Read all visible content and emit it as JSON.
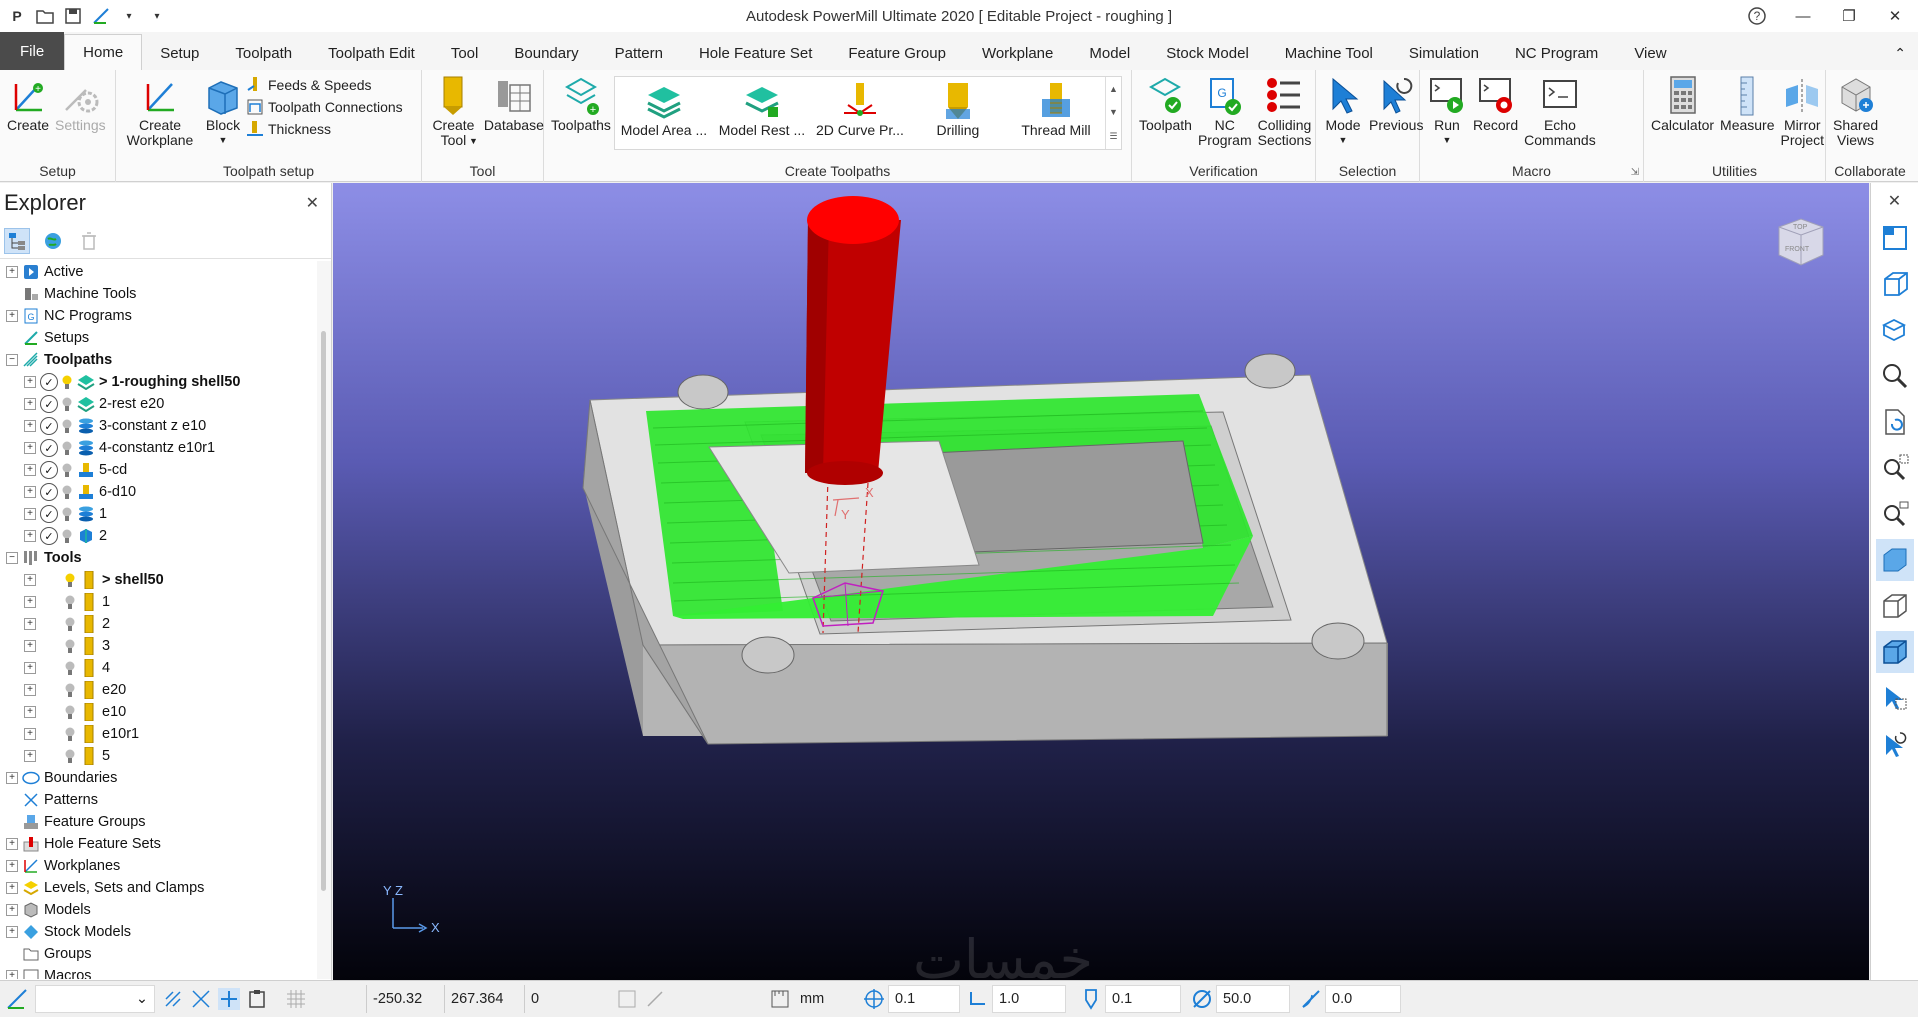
{
  "app": {
    "title": "Autodesk PowerMill Ultimate 2020    [ Editable Project - roughing ]",
    "logo": "P"
  },
  "colors": {
    "accent": "#1e7fd6",
    "toolpath_green": "#33ee33",
    "tool_red": "#d60000",
    "file_tab": "#4b4b4b"
  },
  "tabs": [
    "File",
    "Home",
    "Setup",
    "Toolpath",
    "Toolpath Edit",
    "Tool",
    "Boundary",
    "Pattern",
    "Hole Feature Set",
    "Feature Group",
    "Workplane",
    "Model",
    "Stock Model",
    "Machine Tool",
    "Simulation",
    "NC Program",
    "View"
  ],
  "ribbon": {
    "setup": {
      "label": "Setup",
      "create": "Create",
      "settings": "Settings"
    },
    "toolpath_setup": {
      "label": "Toolpath setup",
      "create_workplane": "Create\nWorkplane",
      "block": "Block",
      "feeds": "Feeds & Speeds",
      "connections": "Toolpath Connections",
      "thickness": "Thickness"
    },
    "tool": {
      "label": "Tool",
      "create_tool": "Create\nTool",
      "database": "Database"
    },
    "create_toolpaths": {
      "label": "Create Toolpaths",
      "toolpaths": "Toolpaths",
      "gallery": [
        "Model Area ...",
        "Model Rest ...",
        "2D Curve Pr...",
        "Drilling",
        "Thread Mill"
      ]
    },
    "verification": {
      "label": "Verification",
      "toolpath": "Toolpath",
      "nc": "NC\nProgram",
      "colliding": "Colliding\nSections"
    },
    "selection": {
      "label": "Selection",
      "mode": "Mode",
      "previous": "Previous"
    },
    "macro": {
      "label": "Macro",
      "run": "Run",
      "record": "Record",
      "echo": "Echo\nCommands"
    },
    "utilities": {
      "label": "Utilities",
      "calculator": "Calculator",
      "measure": "Measure",
      "mirror": "Mirror\nProject"
    },
    "collaborate": {
      "label": "Collaborate",
      "shared": "Shared\nViews"
    }
  },
  "explorer": {
    "title": "Explorer",
    "tree": {
      "active": "Active",
      "machine_tools": "Machine Tools",
      "nc_programs": "NC Programs",
      "setups": "Setups",
      "toolpaths": "Toolpaths",
      "toolpath_items": [
        "> 1-roughing shell50",
        "2-rest e20",
        "3-constant z e10",
        "4-constantz e10r1",
        "5-cd",
        "6-d10",
        "1",
        "2"
      ],
      "tools": "Tools",
      "tool_items": [
        "> shell50",
        "1",
        "2",
        "3",
        "4",
        "e20",
        "e10",
        "e10r1",
        "5"
      ],
      "boundaries": "Boundaries",
      "patterns": "Patterns",
      "feature_groups": "Feature Groups",
      "hole_feature_sets": "Hole Feature Sets",
      "workplanes": "Workplanes",
      "levels": "Levels, Sets and Clamps",
      "models": "Models",
      "stock_models": "Stock Models",
      "groups": "Groups",
      "macros": "Macros"
    }
  },
  "viewport": {
    "axis_x": "X",
    "axis_y": "Y",
    "axis_z": "Z",
    "cube_top": "TOP",
    "cube_front": "FRONT",
    "watermark": "خمسات"
  },
  "status": {
    "x": "-250.32",
    "y": "267.364",
    "z": "0",
    "units": "mm",
    "tolerance": "0.1",
    "factor": "1.0",
    "thickness": "0.1",
    "diameter": "50.0",
    "step": "0.0"
  }
}
